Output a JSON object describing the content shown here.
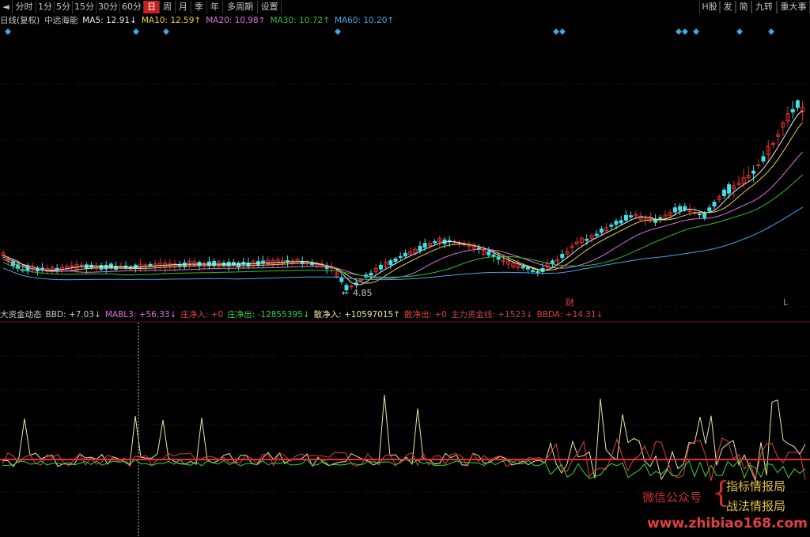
{
  "toolbar": {
    "left": [
      {
        "name": "arrow-left-icon",
        "label": "◄"
      },
      {
        "name": "tab-intraday",
        "label": "分时"
      },
      {
        "name": "tab-1min",
        "label": "1分"
      },
      {
        "name": "tab-5min",
        "label": "5分"
      },
      {
        "name": "tab-15min",
        "label": "15分"
      },
      {
        "name": "tab-30min",
        "label": "30分"
      },
      {
        "name": "tab-60min",
        "label": "60分"
      },
      {
        "name": "tab-day",
        "label": "日",
        "active": true
      },
      {
        "name": "tab-week",
        "label": "周"
      },
      {
        "name": "tab-month",
        "label": "月"
      },
      {
        "name": "tab-season",
        "label": "季"
      },
      {
        "name": "tab-year",
        "label": "年"
      },
      {
        "name": "tab-multi-period",
        "label": "多周期"
      },
      {
        "name": "tab-settings",
        "label": "设置"
      }
    ],
    "right": [
      {
        "name": "tab-h-share",
        "label": "H股"
      },
      {
        "name": "tab-fa",
        "label": "发"
      },
      {
        "name": "tab-jian",
        "label": "简"
      },
      {
        "name": "tab-jiuzhuan",
        "label": "九转"
      },
      {
        "name": "tab-major-events",
        "label": "重大事"
      }
    ]
  },
  "ma_line": {
    "prefix": "日线(复权)",
    "stock": "中远海能",
    "items": [
      {
        "label": "MA5: 12.91↓",
        "color": "#e8e8e8"
      },
      {
        "label": "MA10: 12.59↑",
        "color": "#e8d040"
      },
      {
        "label": "MA20: 10.98↑",
        "color": "#e070e0"
      },
      {
        "label": "MA30: 10.72↑",
        "color": "#30c030"
      },
      {
        "label": "MA60: 10.20↑",
        "color": "#40a8e8"
      }
    ]
  },
  "price_chart": {
    "low_label": "4.85",
    "marker_cai": "财",
    "marker_l": "L",
    "signal_color": "#40a8e0",
    "up_color": "#e03030",
    "down_color": "#40e0e8"
  },
  "indicator_line": {
    "items": [
      {
        "label": "大资金动态",
        "color": "#c8c8c8"
      },
      {
        "label": "BBD: +7.03↓",
        "color": "#c8c8c8"
      },
      {
        "label": "MABL3: +56.33↓",
        "color": "#e070e0"
      },
      {
        "label": "庄净入: +0",
        "color": "#e04040"
      },
      {
        "label": "庄净出: -12855395↓",
        "color": "#40d040"
      },
      {
        "label": "散净入: +10597015↑",
        "color": "#e8e8a0"
      },
      {
        "label": "散净出: +0",
        "color": "#e04040"
      },
      {
        "label": "主力资金线: +1523↓",
        "color": "#c04848"
      },
      {
        "label": "BBDA: +14.31↓",
        "color": "#e04040"
      }
    ]
  },
  "watermark": {
    "wechat": "微信公众号",
    "brace": "{",
    "line1": "指标情报局",
    "line2": "战法情报局",
    "url": "www.zhibiao168.com"
  }
}
